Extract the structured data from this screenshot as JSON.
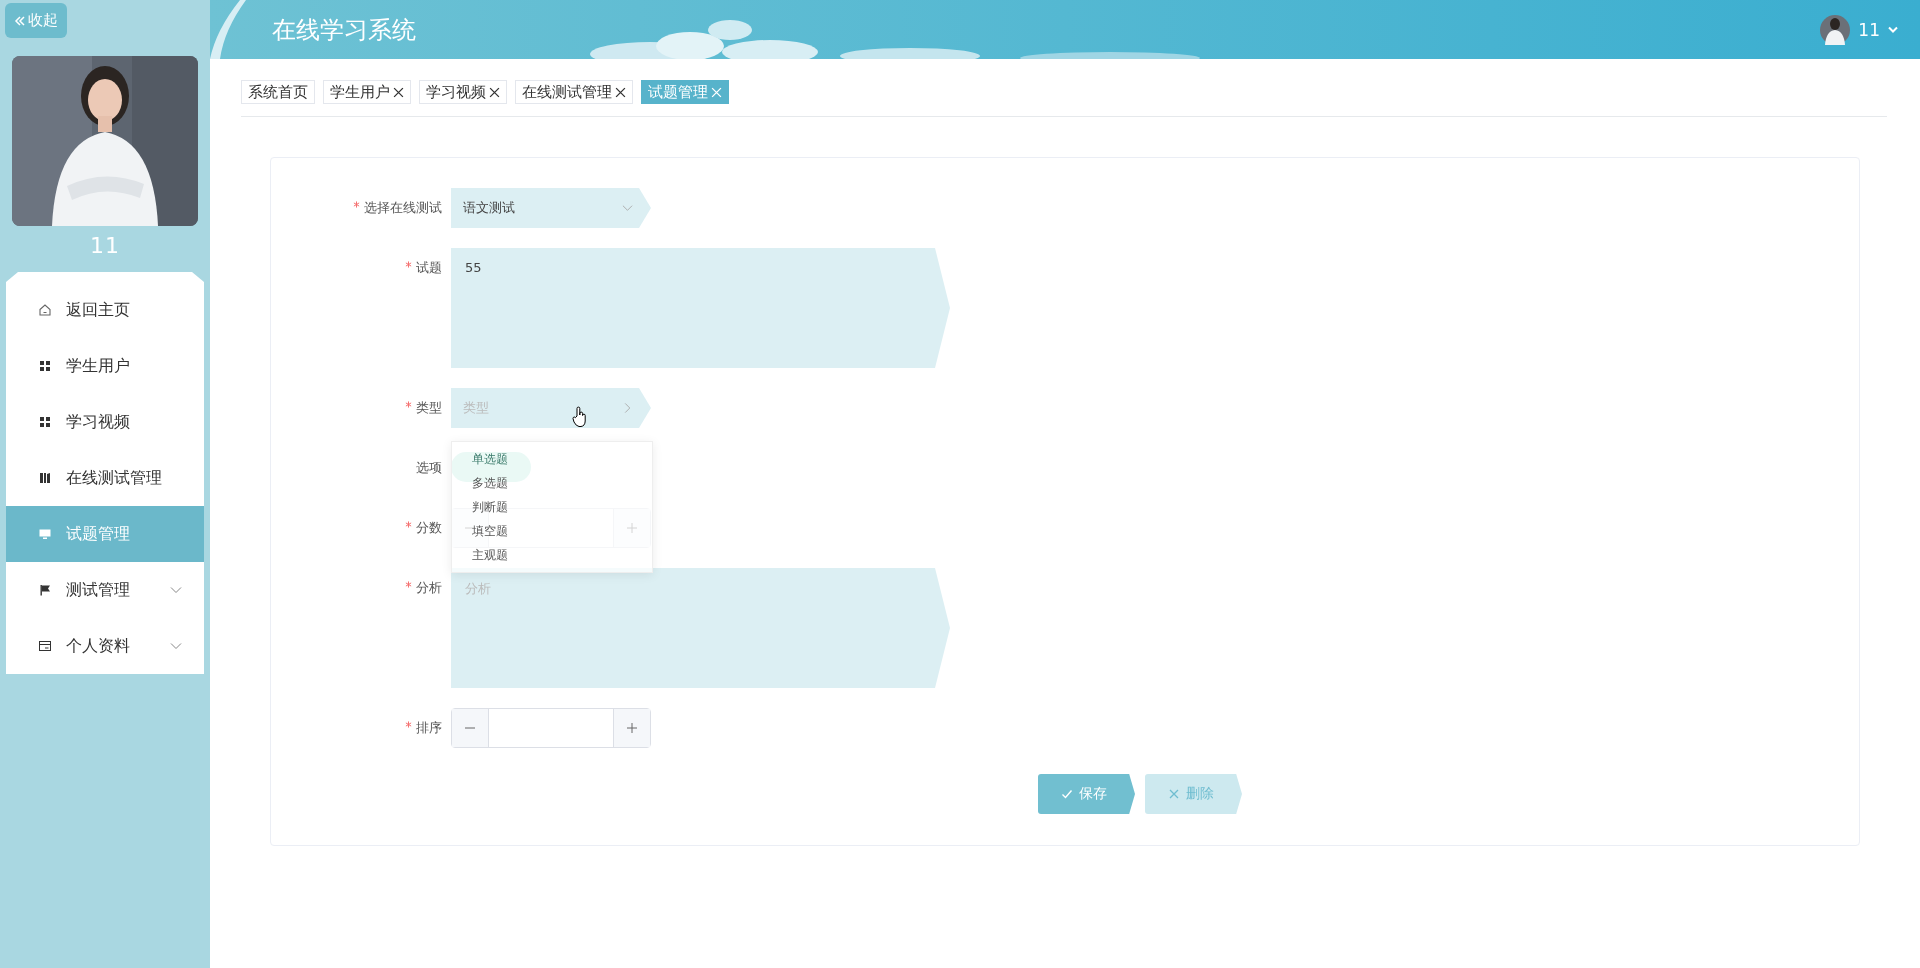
{
  "sidebar": {
    "collapse_button": "收起",
    "user_name": "11",
    "menu": [
      {
        "label": "返回主页",
        "selected": false,
        "expandable": false
      },
      {
        "label": "学生用户",
        "selected": false,
        "expandable": false
      },
      {
        "label": "学习视频",
        "selected": false,
        "expandable": false
      },
      {
        "label": "在线测试管理",
        "selected": false,
        "expandable": false
      },
      {
        "label": "试题管理",
        "selected": true,
        "expandable": false
      },
      {
        "label": "测试管理",
        "selected": false,
        "expandable": true
      },
      {
        "label": "个人资料",
        "selected": false,
        "expandable": true
      }
    ]
  },
  "header": {
    "title": "在线学习系统",
    "user": "11"
  },
  "tabs": [
    {
      "label": "系统首页",
      "closable": false,
      "selected": false
    },
    {
      "label": "学生用户",
      "closable": true,
      "selected": false
    },
    {
      "label": "学习视频",
      "closable": true,
      "selected": false
    },
    {
      "label": "在线测试管理",
      "closable": true,
      "selected": false
    },
    {
      "label": "试题管理",
      "closable": true,
      "selected": true
    }
  ],
  "form": {
    "fields": [
      {
        "kind": "select",
        "label": "选择在线测试",
        "required": true,
        "value": "语文测试",
        "open": false
      },
      {
        "kind": "textarea",
        "label": "试题",
        "required": true,
        "value": "55"
      },
      {
        "kind": "select",
        "label": "类型",
        "required": true,
        "placeholder": "类型",
        "open": true
      },
      {
        "kind": "add",
        "label": "选项",
        "required": false
      },
      {
        "kind": "number",
        "label": "分数",
        "required": true
      },
      {
        "kind": "textarea",
        "label": "分析",
        "required": true,
        "placeholder": "分析"
      },
      {
        "kind": "number",
        "label": "排序",
        "required": true
      }
    ],
    "dropdown": [
      "单选题",
      "多选题",
      "判断题",
      "填空题",
      "主观题"
    ],
    "buttons": [
      {
        "kind": "save",
        "label": "保存"
      },
      {
        "kind": "delete",
        "label": "删除"
      }
    ]
  }
}
